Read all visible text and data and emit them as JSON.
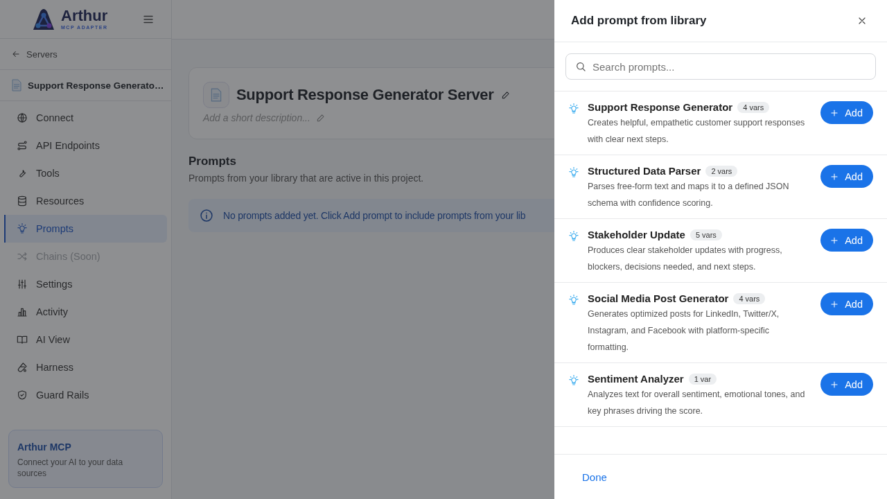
{
  "sidebar": {
    "logo": {
      "name": "Arthur",
      "tagline": "MCP ADAPTER"
    },
    "back_link": "Servers",
    "server": "Support Response Generato…",
    "items": [
      {
        "label": "Connect",
        "selected": false,
        "disabled": false
      },
      {
        "label": "API Endpoints",
        "selected": false,
        "disabled": false
      },
      {
        "label": "Tools",
        "selected": false,
        "disabled": false
      },
      {
        "label": "Resources",
        "selected": false,
        "disabled": false
      },
      {
        "label": "Prompts",
        "selected": true,
        "disabled": false
      },
      {
        "label": "Chains (Soon)",
        "selected": false,
        "disabled": true
      },
      {
        "label": "Settings",
        "selected": false,
        "disabled": false
      },
      {
        "label": "Activity",
        "selected": false,
        "disabled": false
      },
      {
        "label": "AI View",
        "selected": false,
        "disabled": false
      },
      {
        "label": "Harness",
        "selected": false,
        "disabled": false
      },
      {
        "label": "Guard Rails",
        "selected": false,
        "disabled": false
      }
    ],
    "promo": {
      "title": "Arthur MCP",
      "text": "Connect your AI to your data sources"
    }
  },
  "main": {
    "server_title": "Support Response Generator Server",
    "description_placeholder": "Add a short description...",
    "section_title": "Prompts",
    "section_subtitle": "Prompts from your library that are active in this project.",
    "notice": "No prompts added yet. Click Add prompt to include prompts from your lib"
  },
  "dialog": {
    "title": "Add prompt from library",
    "search": {
      "placeholder": "Search prompts..."
    },
    "prompts": [
      {
        "name": "Support Response Generator",
        "vars": "4 vars",
        "description": "Creates helpful, empathetic customer support responses with clear next steps.",
        "action": "Add"
      },
      {
        "name": "Structured Data Parser",
        "vars": "2 vars",
        "description": "Parses free-form text and maps it to a defined JSON schema with confidence scoring.",
        "action": "Add"
      },
      {
        "name": "Stakeholder Update",
        "vars": "5 vars",
        "description": "Produces clear stakeholder updates with progress, blockers, decisions needed, and next steps.",
        "action": "Add"
      },
      {
        "name": "Social Media Post Generator",
        "vars": "4 vars",
        "description": "Generates optimized posts for LinkedIn, Twitter/X, Instagram, and Facebook with platform-specific formatting.",
        "action": "Add"
      },
      {
        "name": "Sentiment Analyzer",
        "vars": "1 var",
        "description": "Analyzes text for overall sentiment, emotional tones, and key phrases driving the score.",
        "action": "Add"
      }
    ],
    "done": "Done"
  }
}
